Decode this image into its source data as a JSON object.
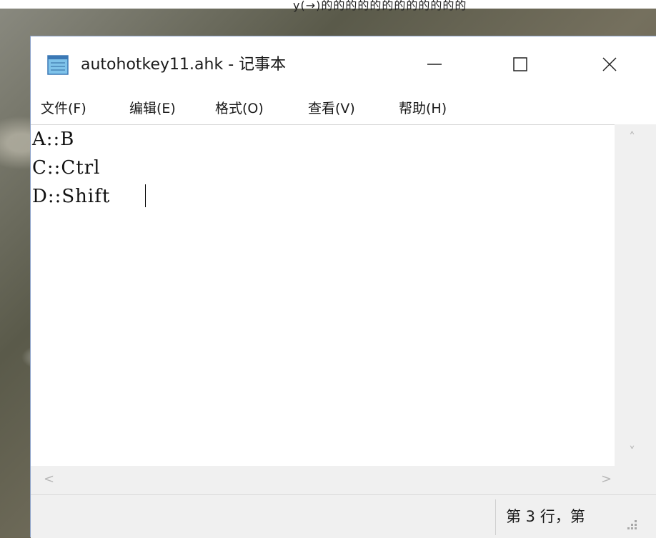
{
  "top_strip_text": "y(→)的的的的的的的的的的的的",
  "window": {
    "title": "autohotkey11.ahk - 记事本",
    "icon": "notepad-icon"
  },
  "menu": {
    "items": [
      "文件(F)",
      "编辑(E)",
      "格式(O)",
      "查看(V)",
      "帮助(H)"
    ]
  },
  "editor": {
    "lines": [
      "A::B",
      "C::Ctrl",
      "D::Shift"
    ]
  },
  "status": {
    "position": "第 3 行，第"
  },
  "colors": {
    "accent": "#8aa0c8",
    "scrollbar": "#f0f0f0"
  }
}
